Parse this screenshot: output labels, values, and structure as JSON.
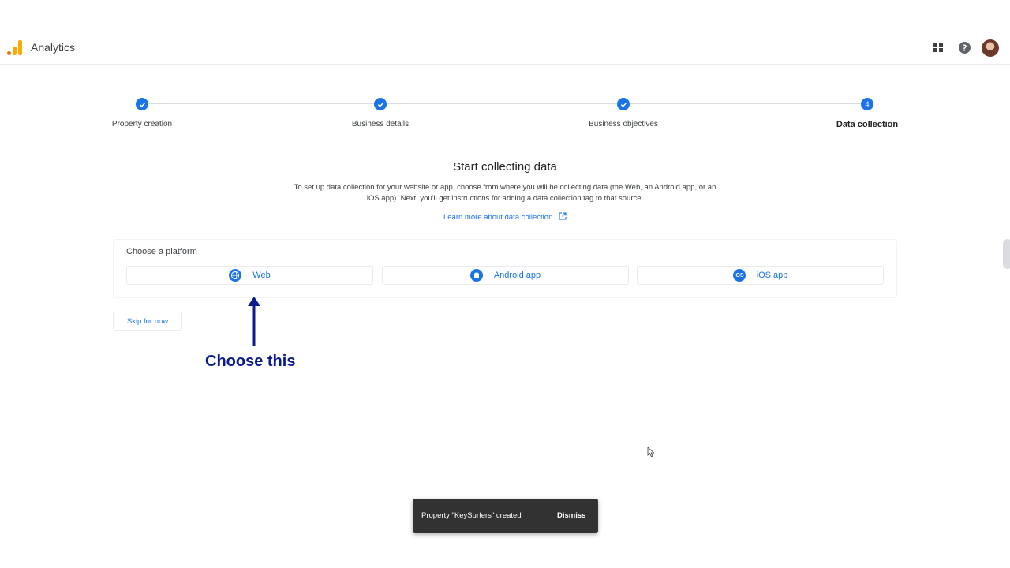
{
  "header": {
    "app_title": "Analytics",
    "icons": [
      "analytics-logo",
      "apps-grid-icon",
      "help-icon",
      "avatar"
    ]
  },
  "stepper": {
    "steps": [
      {
        "label": "Property creation",
        "status": "done"
      },
      {
        "label": "Business details",
        "status": "done"
      },
      {
        "label": "Business objectives",
        "status": "done"
      },
      {
        "label": "Data collection",
        "status": "active",
        "number": "4"
      }
    ]
  },
  "main": {
    "title": "Start collecting data",
    "description": "To set up data collection for your website or app, choose from where you will be collecting data (the Web, an Android app, or an iOS app). Next, you'll get instructions for adding a data collection tag to that source.",
    "learn_more": "Learn more about data collection"
  },
  "platform": {
    "label": "Choose a platform",
    "options": [
      {
        "label": "Web",
        "icon": "globe-icon"
      },
      {
        "label": "Android app",
        "icon": "android-icon"
      },
      {
        "label": "iOS app",
        "icon": "ios-icon",
        "icon_text": "iOS"
      }
    ]
  },
  "skip_label": "Skip for now",
  "annotation": {
    "text": "Choose this",
    "color": "#0b1a8c"
  },
  "snackbar": {
    "message": "Property \"KeySurfers\" created",
    "dismiss": "Dismiss"
  },
  "colors": {
    "accent": "#1a73e8",
    "logo_orange": "#f9ab00",
    "logo_dark_orange": "#e37400"
  }
}
